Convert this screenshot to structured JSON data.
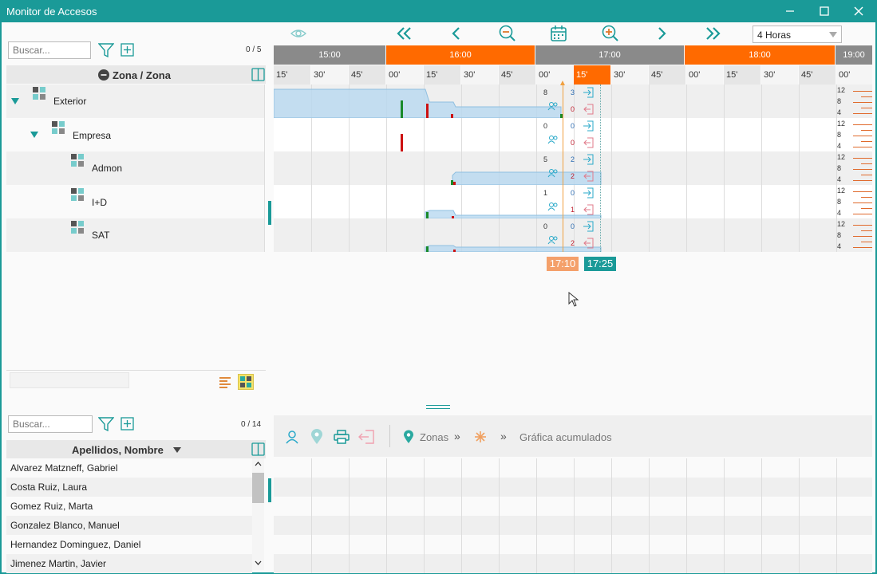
{
  "window": {
    "title": "Monitor de Accesos"
  },
  "zones": {
    "search_placeholder": "Buscar...",
    "count": "0 / 5",
    "column_header": "Zona / Zona",
    "items": [
      {
        "label": "Exterior"
      },
      {
        "label": "Empresa"
      },
      {
        "label": "Admon"
      },
      {
        "label": "I+D"
      },
      {
        "label": "SAT"
      }
    ]
  },
  "timeline": {
    "range_select": "4 Horas",
    "hours": [
      "15:00",
      "16:00",
      "17:00",
      "18:00",
      "19:00"
    ],
    "minutes": [
      "15'",
      "30'",
      "45'",
      "00'",
      "15'",
      "30'",
      "45'",
      "00'",
      "15'",
      "30'",
      "45'",
      "00'",
      "15'",
      "30'",
      "45'",
      "00'"
    ],
    "cursor_time": "17:10",
    "end_time": "17:25",
    "scale_ticks": [
      "12",
      "8",
      "4"
    ],
    "rows": [
      {
        "total": "8",
        "in": "3",
        "out": "0"
      },
      {
        "total": "0",
        "in": "0",
        "out": "0"
      },
      {
        "total": "5",
        "in": "2",
        "out": "2"
      },
      {
        "total": "1",
        "in": "0",
        "out": "1"
      },
      {
        "total": "0",
        "in": "0",
        "out": "2"
      }
    ]
  },
  "people": {
    "search_placeholder": "Buscar...",
    "count": "0 / 14",
    "column_header": "Apellidos, Nombre",
    "items": [
      "Alvarez Matzneff, Gabriel",
      "Costa Ruiz, Laura",
      "Gomez Ruiz, Marta",
      "Gonzalez Blanco, Manuel",
      "Hernandez Dominguez, Daniel",
      "Jimenez Martin, Javier"
    ]
  },
  "breadcrumb": {
    "zones_label": "Zonas",
    "chart_label": "Gráfica acumulados"
  },
  "colors": {
    "teal": "#1a9a98",
    "orange": "#ff6a00",
    "gray_hour": "#8a8a8a"
  }
}
